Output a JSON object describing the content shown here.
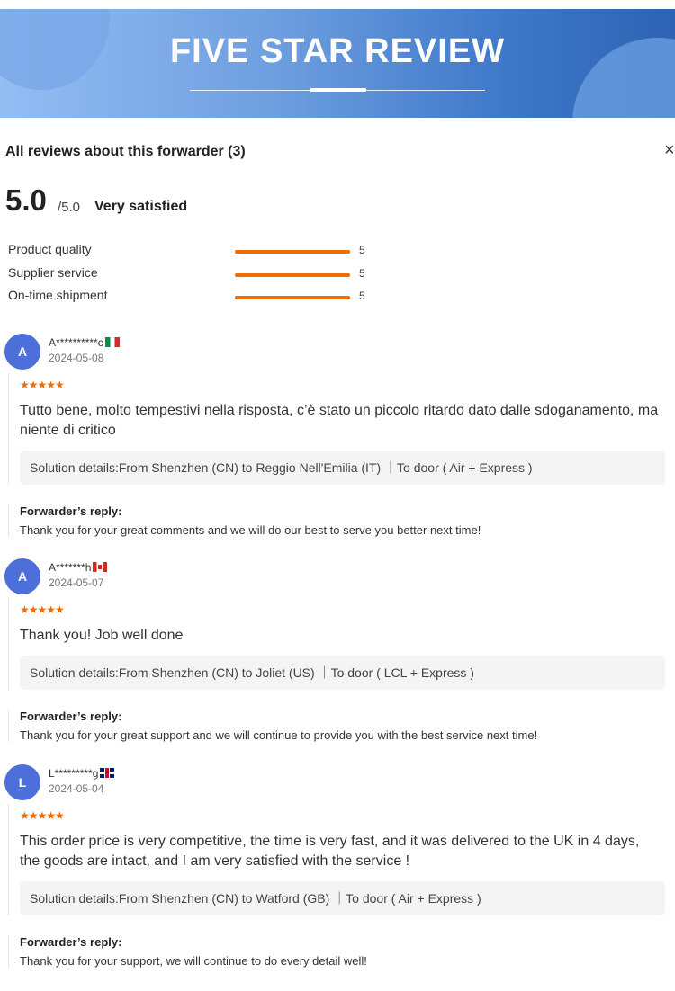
{
  "banner": {
    "title": "FIVE STAR REVIEW"
  },
  "panel": {
    "title": "All reviews about this forwarder (3)",
    "close_label": "×"
  },
  "summary": {
    "score": "5.0",
    "max": "/5.0",
    "text": "Very satisfied"
  },
  "metrics": [
    {
      "label": "Product quality",
      "value": "5",
      "fill": 1.0
    },
    {
      "label": "Supplier service",
      "value": "5",
      "fill": 1.0
    },
    {
      "label": "On-time shipment",
      "value": "5",
      "fill": 1.0
    }
  ],
  "colors": {
    "accent": "#f06c00",
    "avatar": "#4d6fd9",
    "banner_dark": "#2f63b3",
    "banner_light": "#93bdf3"
  },
  "reply_label": "Forwarder’s reply:",
  "reviews": [
    {
      "initial": "A",
      "name": "A**********c",
      "flag": "italy-flag",
      "date": "2024-05-08",
      "stars": "★★★★★",
      "rating": 5,
      "text": "Tutto bene, molto tempestivi nella risposta, c’è stato un piccolo ritardo dato dalle sdoganamento, ma niente di critico",
      "solution": "Solution details:From Shenzhen (CN) to Reggio Nell'Emilia (IT) ｜To door ( Air + Express )",
      "reply": "Thank you for your great comments and we will do our best to serve you better next time!"
    },
    {
      "initial": "A",
      "name": "A*******h",
      "flag": "canada-flag",
      "date": "2024-05-07",
      "stars": "★★★★★",
      "rating": 5,
      "text": "Thank you! Job well done",
      "solution": "Solution details:From Shenzhen (CN) to Joliet (US) ｜To door ( LCL + Express )",
      "reply": "Thank you for your great support and we will continue to provide you with the best service next time!"
    },
    {
      "initial": "L",
      "name": "L*********g",
      "flag": "uk-flag",
      "date": "2024-05-04",
      "stars": "★★★★★",
      "rating": 5,
      "text": "This order price is very competitive, the time is very fast, and it was delivered to the UK in 4 days, the goods are intact, and I am very satisfied with the service !",
      "solution": "Solution details:From Shenzhen (CN) to Watford (GB) ｜To door ( Air + Express )",
      "reply": "Thank you for your support, we will continue to do every detail well!"
    }
  ]
}
